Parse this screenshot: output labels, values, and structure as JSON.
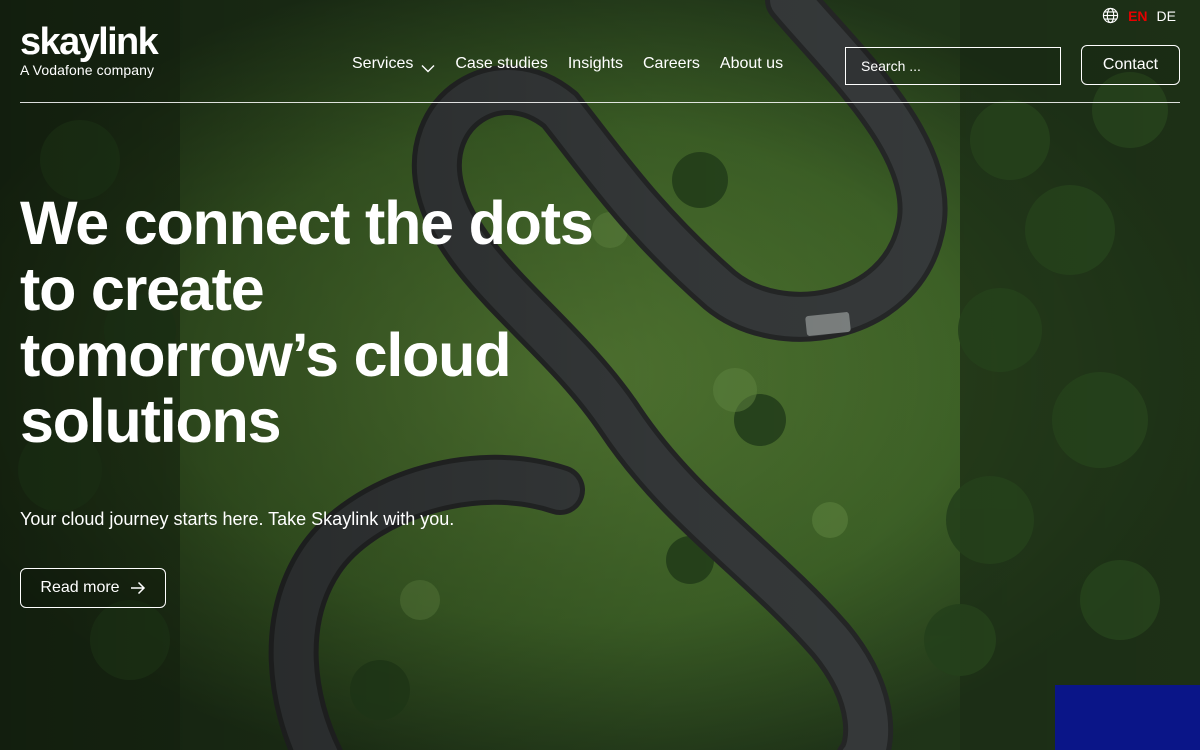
{
  "header": {
    "logo_text": "skaylink",
    "logo_tagline": "A Vodafone company",
    "language": {
      "icon": "globe-icon",
      "options": [
        {
          "code": "EN",
          "active": true
        },
        {
          "code": "DE",
          "active": false
        }
      ],
      "active_color": "#e60000"
    },
    "nav": {
      "items": [
        {
          "label": "Services",
          "dropdown": true
        },
        {
          "label": "Case studies"
        },
        {
          "label": "Insights"
        },
        {
          "label": "Careers"
        },
        {
          "label": "About us"
        }
      ]
    },
    "search": {
      "placeholder": "Search ..."
    },
    "contact_label": "Contact"
  },
  "hero": {
    "title_lines": [
      "We connect the dots",
      "to create",
      "tomorrow’s cloud",
      "solutions"
    ],
    "subtitle": "Your cloud journey starts here. Take Skaylink with you.",
    "cta": {
      "label": "Read more",
      "icon": "arrow-right-icon"
    }
  },
  "colors": {
    "text": "#ffffff",
    "accent_red": "#e60000",
    "corner_block": "#0a1588",
    "forest": "#2f4a24",
    "road": "#3a3d3e"
  }
}
